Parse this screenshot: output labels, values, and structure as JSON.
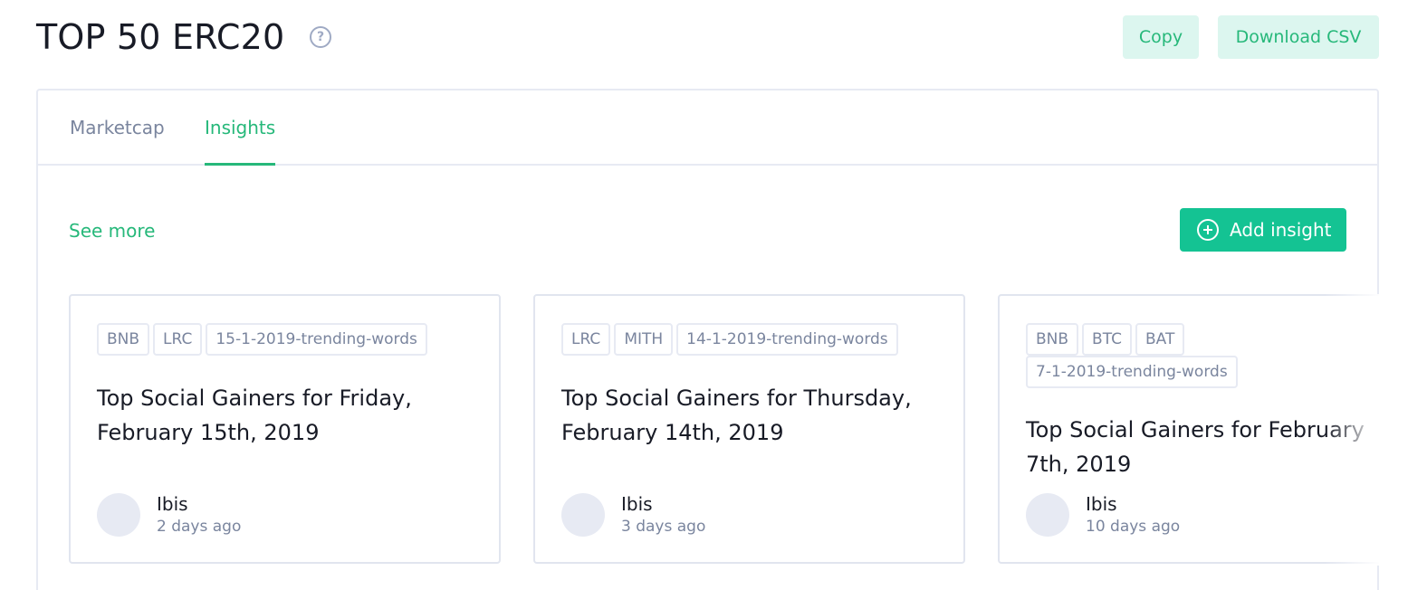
{
  "header": {
    "title": "TOP 50 ERC20",
    "help_icon": "question-circle-icon",
    "copy_label": "Copy",
    "download_label": "Download CSV"
  },
  "tabs": [
    {
      "label": "Marketcap",
      "active": false
    },
    {
      "label": "Insights",
      "active": true
    }
  ],
  "insights": {
    "see_more_label": "See more",
    "add_label": "Add insight",
    "add_icon": "plus-circle-icon",
    "cards": [
      {
        "tags": [
          "BNB",
          "LRC",
          "15-1-2019-trending-words"
        ],
        "title": "Top Social Gainers for Friday, February 15th, 2019",
        "author": "Ibis",
        "time": "2 days ago"
      },
      {
        "tags": [
          "LRC",
          "MITH",
          "14-1-2019-trending-words"
        ],
        "title": "Top Social Gainers for Thursday, February 14th, 2019",
        "author": "Ibis",
        "time": "3 days ago"
      },
      {
        "tags": [
          "BNB",
          "BTC",
          "BAT",
          "7-1-2019-trending-words"
        ],
        "title": "Top Social Gainers for February 7th, 2019",
        "author": "Ibis",
        "time": "10 days ago"
      }
    ]
  },
  "colors": {
    "accent": "#26b87a",
    "button_primary": "#14c393",
    "button_light": "#dcf6ef",
    "muted": "#7a859e",
    "border": "#e7eaf3"
  }
}
